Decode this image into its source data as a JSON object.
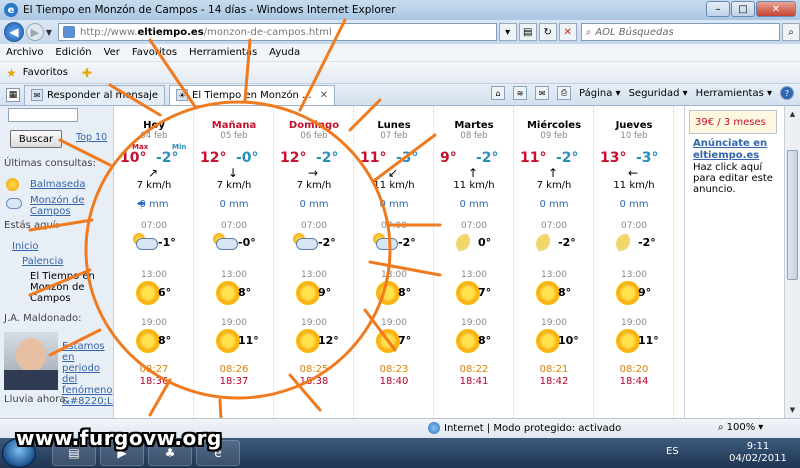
{
  "window": {
    "title": "El Tiempo en Monzón de Campos - 14 días - Windows Internet Explorer"
  },
  "address": {
    "url_prefix": "http://www.",
    "url_domain": "eltiempo.es",
    "url_path": "/monzon-de-campos.html",
    "search_placeholder": "AOL Búsquedas"
  },
  "menu": [
    "Archivo",
    "Edición",
    "Ver",
    "Favoritos",
    "Herramientas",
    "Ayuda"
  ],
  "favorites": {
    "label": "Favoritos"
  },
  "tabs": [
    {
      "label": "Responder al mensaje"
    },
    {
      "label": "El Tiempo en Monzón ..."
    }
  ],
  "commands": {
    "page": "Página",
    "security": "Seguridad",
    "tools": "Herramientas"
  },
  "left": {
    "search_button": "Buscar",
    "top10": "Top 10",
    "recent_heading": "Últimas consultas:",
    "recent": [
      "Balmaseda",
      "Monzón de Campos"
    ],
    "here_heading": "Estás aquí:",
    "crumb1": "Inicio",
    "crumb2": "Palencia",
    "crumb3": "El Tiempo en Monzón de Campos",
    "author_heading": "J.A. Maldonado:",
    "article": "Estamos en periodo del fenómeno &#8220;L...",
    "rain_heading": "Lluvia ahora:"
  },
  "forecast": {
    "max_label": "Max",
    "min_label": "Min",
    "days": [
      {
        "name": "Hoy",
        "date": "04 feb",
        "max": "10°",
        "min": "-2°",
        "arrow": "↗",
        "wind": "7 km/h",
        "rain": "0 mm",
        "rain_icon": true,
        "t1": "07:00",
        "v1": "-1°",
        "i1": "cloud",
        "t2": "13:00",
        "v2": "6°",
        "i2": "sun",
        "t3": "19:00",
        "v3": "8°",
        "i3": "sun",
        "sunrise": "08:27",
        "sunset": "18:36",
        "red": false
      },
      {
        "name": "Mañana",
        "date": "05 feb",
        "max": "12°",
        "min": "-0°",
        "arrow": "↓",
        "wind": "7 km/h",
        "rain": "0 mm",
        "rain_icon": false,
        "t1": "07:00",
        "v1": "-0°",
        "i1": "cloud",
        "t2": "13:00",
        "v2": "8°",
        "i2": "sun",
        "t3": "19:00",
        "v3": "11°",
        "i3": "sun",
        "sunrise": "08:26",
        "sunset": "18:37",
        "red": true
      },
      {
        "name": "Domingo",
        "date": "06 feb",
        "max": "12°",
        "min": "-2°",
        "arrow": "→",
        "wind": "7 km/h",
        "rain": "0 mm",
        "rain_icon": false,
        "t1": "07:00",
        "v1": "-2°",
        "i1": "cloud",
        "t2": "13:00",
        "v2": "9°",
        "i2": "sun",
        "t3": "19:00",
        "v3": "12°",
        "i3": "sun",
        "sunrise": "08:25",
        "sunset": "18:38",
        "red": true
      },
      {
        "name": "Lunes",
        "date": "07 feb",
        "max": "11°",
        "min": "-3°",
        "arrow": "↙",
        "wind": "11 km/h",
        "rain": "0 mm",
        "rain_icon": false,
        "t1": "07:00",
        "v1": "-2°",
        "i1": "cloud",
        "t2": "13:00",
        "v2": "8°",
        "i2": "sun",
        "t3": "19:00",
        "v3": "7°",
        "i3": "sun",
        "sunrise": "08:23",
        "sunset": "18:40",
        "red": false
      },
      {
        "name": "Martes",
        "date": "08 feb",
        "max": "9°",
        "min": "-2°",
        "arrow": "↑",
        "wind": "11 km/h",
        "rain": "0 mm",
        "rain_icon": false,
        "t1": "07:00",
        "v1": "0°",
        "i1": "moon",
        "t2": "13:00",
        "v2": "7°",
        "i2": "sun",
        "t3": "19:00",
        "v3": "8°",
        "i3": "sun",
        "sunrise": "08:22",
        "sunset": "18:41",
        "red": false
      },
      {
        "name": "Miércoles",
        "date": "09 feb",
        "max": "11°",
        "min": "-2°",
        "arrow": "↑",
        "wind": "7 km/h",
        "rain": "0 mm",
        "rain_icon": false,
        "t1": "07:00",
        "v1": "-2°",
        "i1": "moon",
        "t2": "13:00",
        "v2": "8°",
        "i2": "sun",
        "t3": "19:00",
        "v3": "10°",
        "i3": "sun",
        "sunrise": "08:21",
        "sunset": "18:42",
        "red": false
      },
      {
        "name": "Jueves",
        "date": "10 feb",
        "max": "13°",
        "min": "-3°",
        "arrow": "←",
        "wind": "11 km/h",
        "rain": "0 mm",
        "rain_icon": false,
        "t1": "07:00",
        "v1": "-2°",
        "i1": "moon",
        "t2": "13:00",
        "v2": "9°",
        "i2": "sun",
        "t3": "19:00",
        "v3": "11°",
        "i3": "sun",
        "sunrise": "08:20",
        "sunset": "18:44",
        "red": false
      }
    ]
  },
  "right": {
    "price": "39€ / 3 meses",
    "ad_link": "Anúnciate en eltiempo.es",
    "ad_text": "Haz click aquí para editar este anuncio."
  },
  "status": {
    "zone": "Internet | Modo protegido: activado",
    "zoom": "100%"
  },
  "taskbar": {
    "lang": "ES",
    "time": "9:11",
    "date": "04/02/2011"
  },
  "watermark": "www.furgovw.org",
  "colors": {
    "accent_red": "#c4112f",
    "accent_blue": "#2a8fc0",
    "link": "#3366aa",
    "sun_stroke": "#f07a1e"
  }
}
